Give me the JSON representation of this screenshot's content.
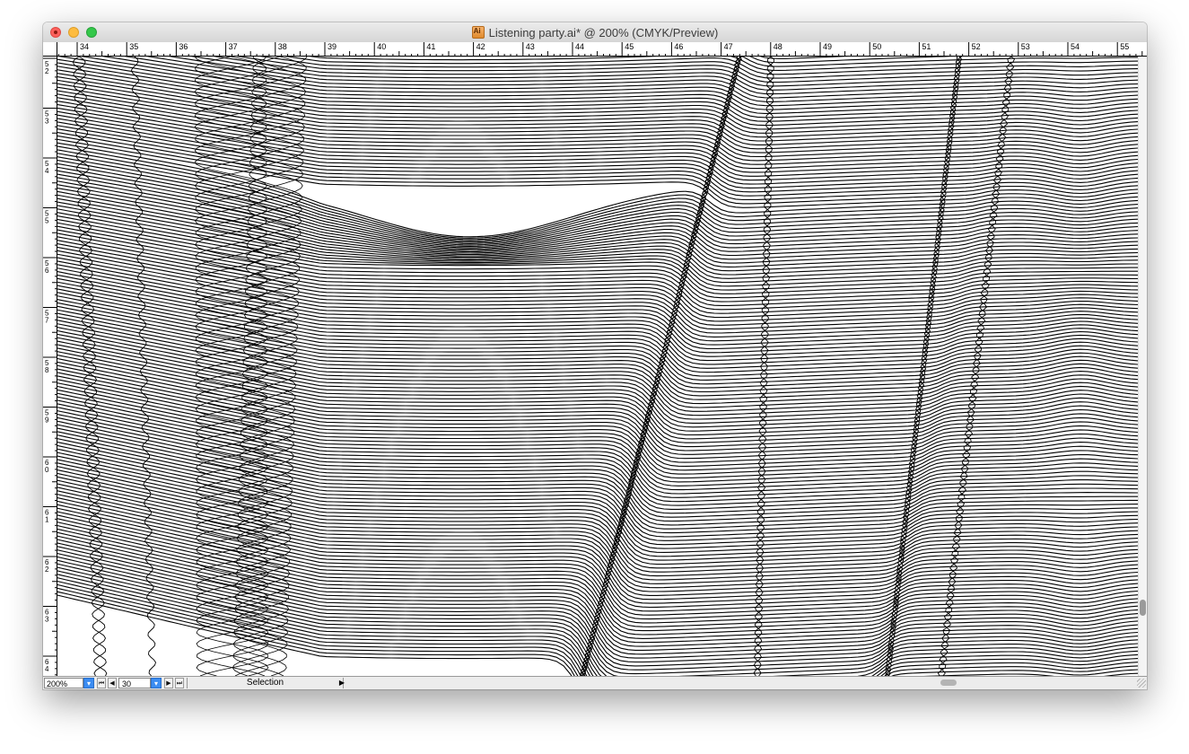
{
  "window": {
    "title": "Listening party.ai* @ 200% (CMYK/Preview)",
    "document_icon": "illustrator-document-icon"
  },
  "rulers": {
    "top_labels": [
      "34",
      "35",
      "36",
      "37",
      "38",
      "39",
      "40",
      "41",
      "42",
      "43",
      "44",
      "45",
      "46",
      "47",
      "48",
      "49",
      "50",
      "51",
      "52",
      "53",
      "54",
      "55"
    ],
    "left_labels": [
      [
        "5",
        "2"
      ],
      [
        "5",
        "3"
      ],
      [
        "5",
        "4"
      ],
      [
        "5",
        "5"
      ],
      [
        "5",
        "6"
      ],
      [
        "5",
        "7"
      ],
      [
        "5",
        "8"
      ],
      [
        "5",
        "9"
      ],
      [
        "6",
        "0"
      ],
      [
        "6",
        "1"
      ],
      [
        "6",
        "2"
      ],
      [
        "6",
        "3"
      ],
      [
        "6",
        "4"
      ]
    ]
  },
  "status_bar": {
    "zoom": "200%",
    "artboard": "30",
    "status": "Selection",
    "zoom_menu_icon": "chevron-down-icon",
    "artboard_menu_icon": "chevron-down-icon",
    "first_icon": "first-artboard-icon",
    "prev_icon": "previous-artboard-icon",
    "next_icon": "next-artboard-icon",
    "last_icon": "last-artboard-icon",
    "status_menu_icon": "triangle-right-icon"
  }
}
